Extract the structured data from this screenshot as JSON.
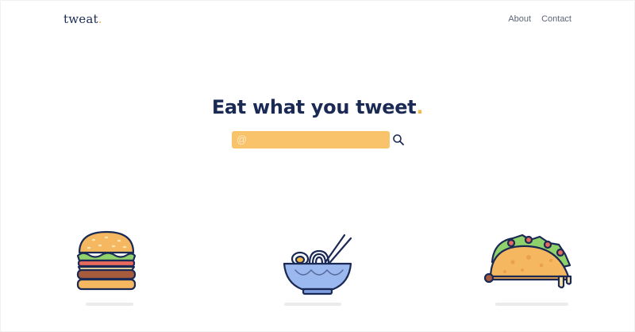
{
  "brand": {
    "name": "tweat",
    "dot": "."
  },
  "nav": {
    "items": [
      {
        "label": "About"
      },
      {
        "label": "Contact"
      }
    ]
  },
  "hero": {
    "title": "Eat what you tweet",
    "title_dot": "."
  },
  "search": {
    "prefix": "@",
    "value": "",
    "placeholder": "",
    "button_icon": "search-icon"
  },
  "illustrations": [
    "burger-illustration",
    "ramen-bowl-illustration",
    "taco-illustration"
  ],
  "colors": {
    "navy": "#1b2a55",
    "accent": "#f2b84b",
    "search_bg": "#f8c36b",
    "nav_text": "#5d6677"
  }
}
